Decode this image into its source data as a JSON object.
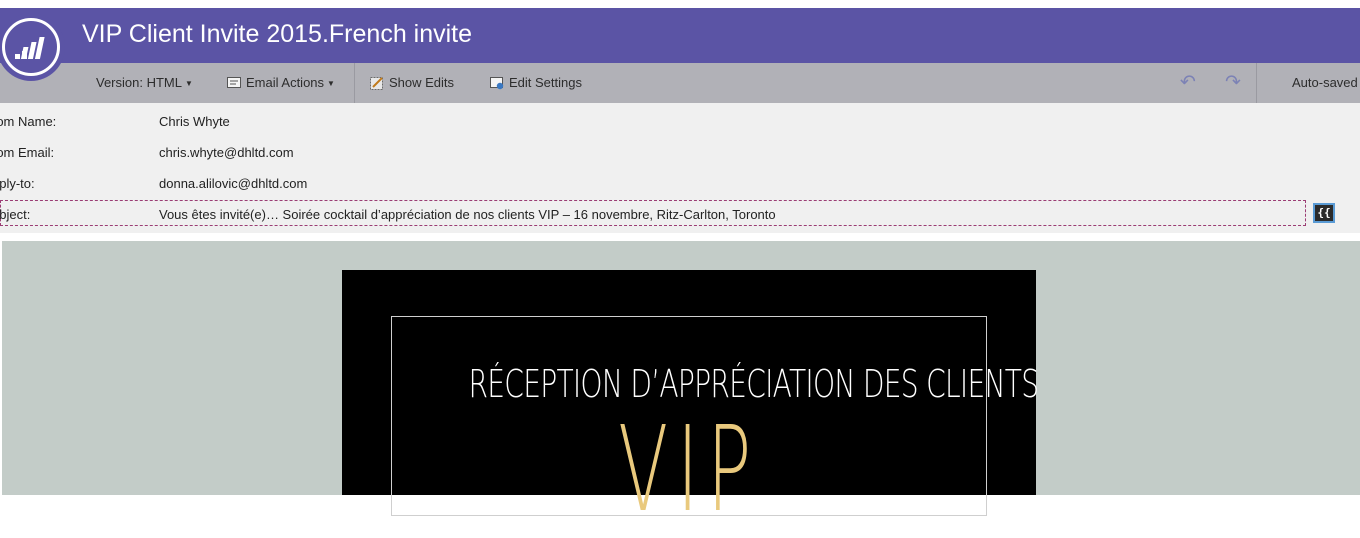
{
  "app": {
    "title": "VIP Client Invite 2015.French invite"
  },
  "toolbar": {
    "version_label": "Version: HTML",
    "email_actions_label": "Email Actions",
    "show_edits_label": "Show Edits",
    "edit_settings_label": "Edit Settings",
    "autosave_label": "Auto-saved"
  },
  "fields": {
    "from_name_label": "rom Name:",
    "from_name_value": "Chris Whyte",
    "from_email_label": "rom Email:",
    "from_email_value": "chris.whyte@dhltd.com",
    "reply_to_label": "eply-to:",
    "reply_to_value": "donna.alilovic@dhltd.com",
    "subject_label": "ubject:",
    "subject_value": "Vous êtes invité(e)… Soirée cocktail d’appréciation de nos clients VIP – 16 novembre, Ritz-Carlton, Toronto",
    "token_button_label": "{{"
  },
  "email_preview": {
    "heading": "RÉCEPTION D’APPRÉCIATION DES CLIENTS",
    "big_text": "VIP"
  },
  "colors": {
    "header": "#5b54a5",
    "toolbar": "#b1b1b7",
    "canvas": "#c3ccc8",
    "gold": "#e9c97d"
  }
}
